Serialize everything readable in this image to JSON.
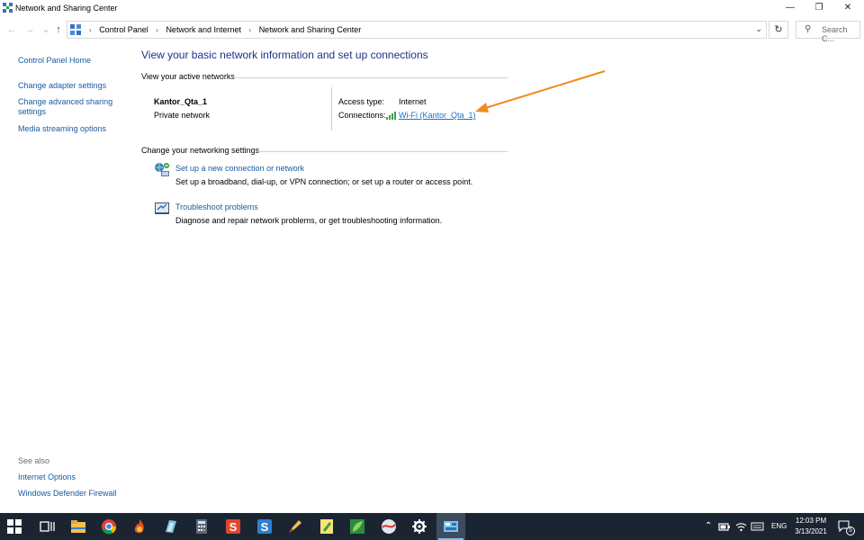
{
  "window": {
    "title": "Network and Sharing Center",
    "controls": {
      "minimize": "—",
      "restore": "❐",
      "close": "✕"
    }
  },
  "address_bar": {
    "breadcrumbs": [
      "Control Panel",
      "Network and Internet",
      "Network and Sharing Center"
    ],
    "search_placeholder": "Search C..."
  },
  "sidebar": {
    "items": [
      "Control Panel Home",
      "Change adapter settings",
      "Change advanced sharing settings",
      "Media streaming options"
    ],
    "see_also_label": "See also",
    "see_also": [
      "Internet Options",
      "Windows Defender Firewall"
    ]
  },
  "main": {
    "heading": "View your basic network information and set up connections",
    "active_networks_label": "View your active networks",
    "network": {
      "name": "Kantor_Qta_1",
      "type": "Private network",
      "access_type_label": "Access type:",
      "access_type_value": "Internet",
      "connections_label": "Connections:",
      "connection_link": "Wi-Fi (Kantor_Qta_1)"
    },
    "change_settings_label": "Change your networking settings",
    "tasks": [
      {
        "link": "Set up a new connection or network",
        "desc": "Set up a broadband, dial-up, or VPN connection; or set up a router or access point."
      },
      {
        "link": "Troubleshoot problems",
        "desc": "Diagnose and repair network problems, or get troubleshooting information."
      }
    ]
  },
  "taskbar": {
    "language": "ENG",
    "time": "12:03 PM",
    "date": "3/13/2021",
    "notification_count": "5"
  },
  "colors": {
    "link": "#1a5a9e",
    "heading": "#1e3287",
    "annotation_arrow": "#f08a1c",
    "taskbar": "#1b2532"
  }
}
